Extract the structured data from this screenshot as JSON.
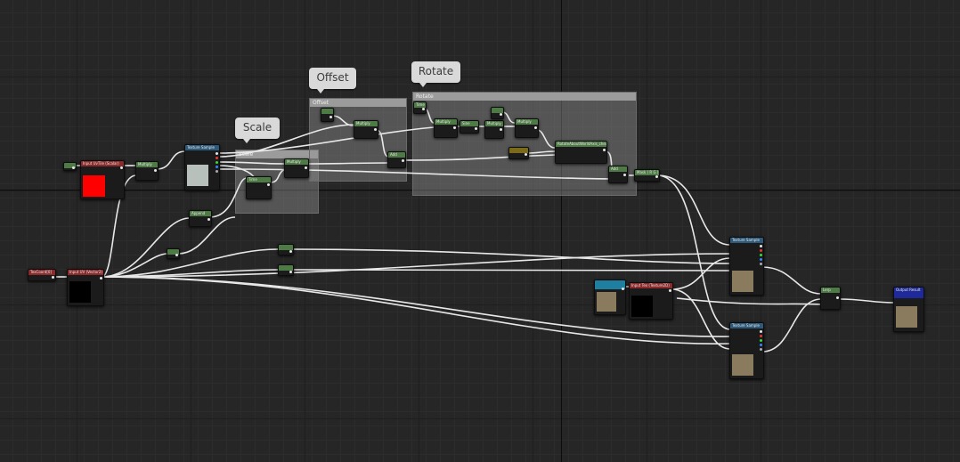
{
  "comments": {
    "scale": {
      "header": "Scale",
      "bubble": "Scale"
    },
    "offset": {
      "header": "Offset",
      "bubble": "Offset"
    },
    "rotate": {
      "header": "Rotate",
      "bubble": "Rotate"
    }
  },
  "nodes": {
    "input_uv_tile": "Input UvTile (Scalar)",
    "input_uv": "Input UV (Vector2)",
    "texcoord": "TexCoord[0]",
    "texture_sample_top": "Texture Sample",
    "texture_sample_mid": "Texture Sample",
    "texture_sample_bot": "Texture Sample",
    "input_tex": "Input Tex (Texture2D)",
    "output_result": "Output Result",
    "lerp": "Lerp",
    "mask_rg": "Mask ( R G )",
    "rotate_about_axis": "RotateAboutWorldAxis_cheap",
    "multiply": "Multiply",
    "sine": "Sine",
    "time": "Time",
    "append": "Append",
    "add": "Add"
  },
  "colors": {
    "wire": "#e8e8e8",
    "uv_tile_preview": "#ff0000",
    "texture_preview": "#8a7a5e"
  }
}
